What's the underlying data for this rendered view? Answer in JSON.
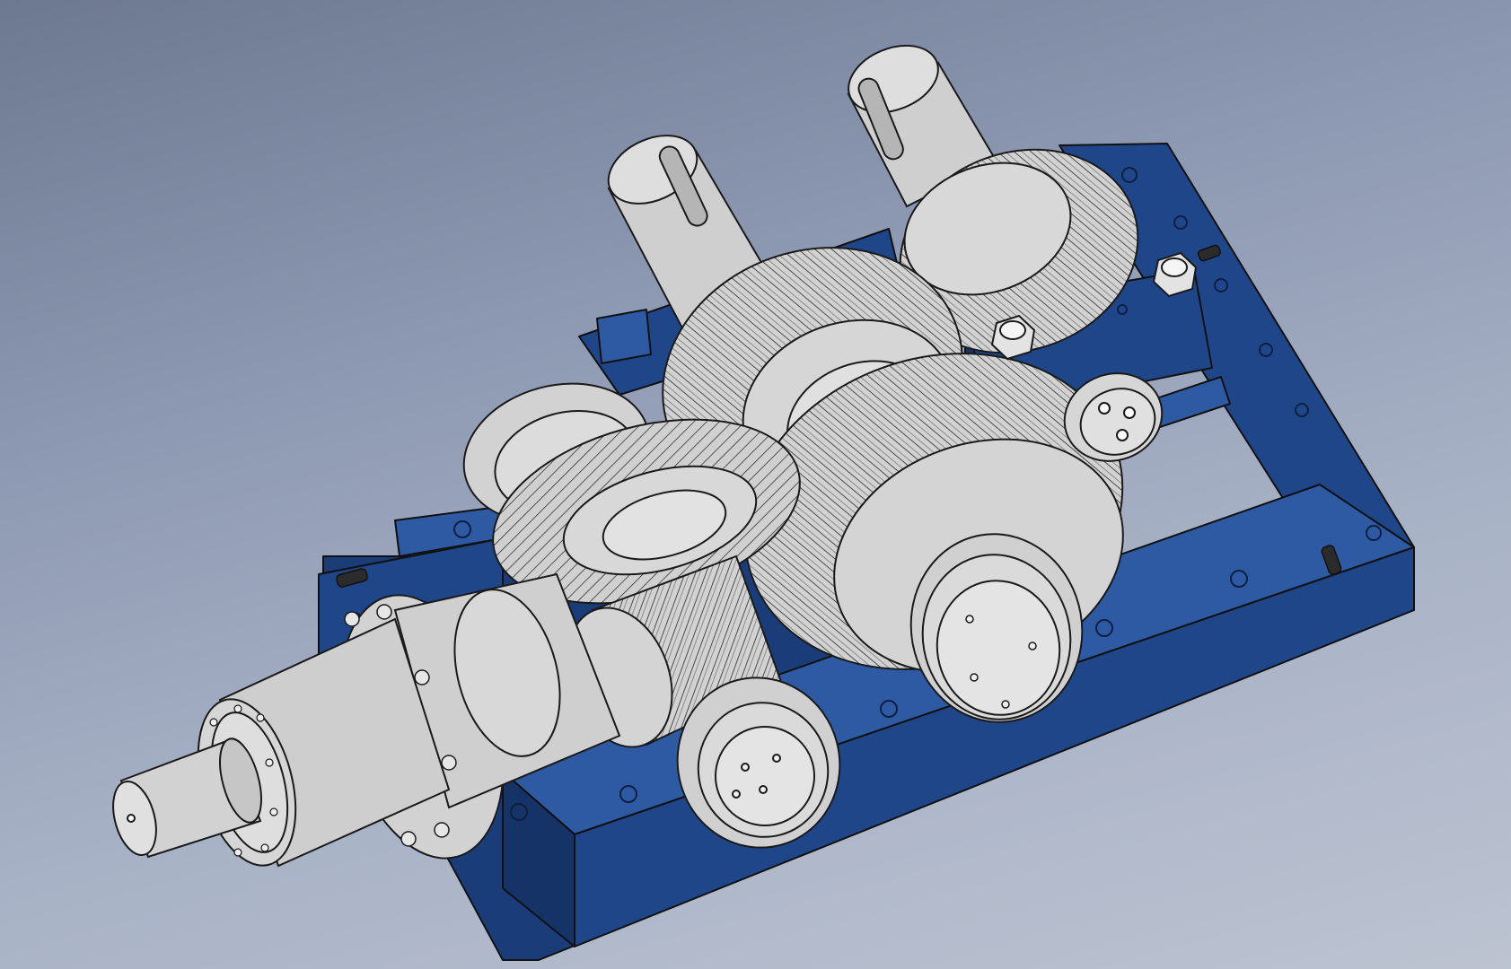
{
  "viewport": {
    "background_top": "#6d7891",
    "background_bottom": "#bcc3d1"
  },
  "model": {
    "housing_color": "#1f4689",
    "housing_dark": "#163368",
    "housing_light": "#2d5aa3",
    "metal_color": "#cfcfcf",
    "metal_light": "#e2e2e2",
    "metal_dark": "#a9a9a9",
    "edge_color": "#1a1a1a"
  }
}
